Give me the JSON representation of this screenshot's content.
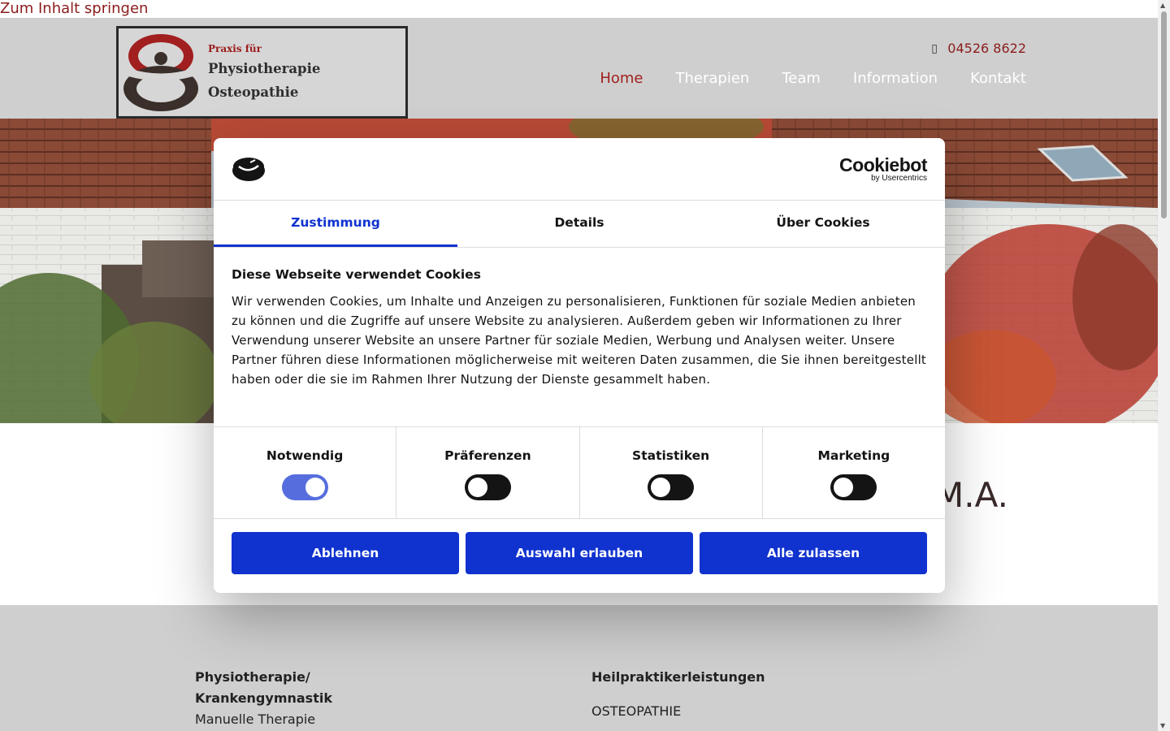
{
  "skip_link": "Zum Inhalt springen",
  "logo": {
    "line1": "Praxis für",
    "line2": "Physiotherapie",
    "line3": "Osteopathie"
  },
  "header": {
    "phone_icon": "phone-icon",
    "phone": "04526 8622",
    "nav": [
      "Home",
      "Therapien",
      "Team",
      "Information",
      "Kontakt"
    ],
    "active_nav": "Home"
  },
  "main": {
    "partial_heading": "M.A."
  },
  "footer": {
    "col1_title_line1": "Physiotherapie/",
    "col1_title_line2": "Krankengymnastik",
    "col1_item1": "Manuelle Therapie",
    "col2_title": "Heilpraktikerleistungen",
    "col2_item1": "OSTEOPATHIE"
  },
  "cookie_dialog": {
    "brand": "Cookiebot",
    "brand_sub": "by Usercentrics",
    "tabs": [
      "Zustimmung",
      "Details",
      "Über Cookies"
    ],
    "active_tab": "Zustimmung",
    "title": "Diese Webseite verwendet Cookies",
    "text": "Wir verwenden Cookies, um Inhalte und Anzeigen zu personalisieren, Funktionen für soziale Medien anbieten zu können und die Zugriffe auf unsere Website zu analysieren. Außerdem geben wir Informationen zu Ihrer Verwendung unserer Website an unsere Partner für soziale Medien, Werbung und Analysen weiter. Unsere Partner führen diese Informationen möglicherweise mit weiteren Daten zusammen, die Sie ihnen bereitgestellt haben oder die sie im Rahmen Ihrer Nutzung der Dienste gesammelt haben.",
    "toggles": [
      {
        "label": "Notwendig",
        "on": true
      },
      {
        "label": "Präferenzen",
        "on": false
      },
      {
        "label": "Statistiken",
        "on": false
      },
      {
        "label": "Marketing",
        "on": false
      }
    ],
    "buttons": [
      "Ablehnen",
      "Auswahl erlauben",
      "Alle zulassen"
    ],
    "accent_color": "#1032cf"
  }
}
